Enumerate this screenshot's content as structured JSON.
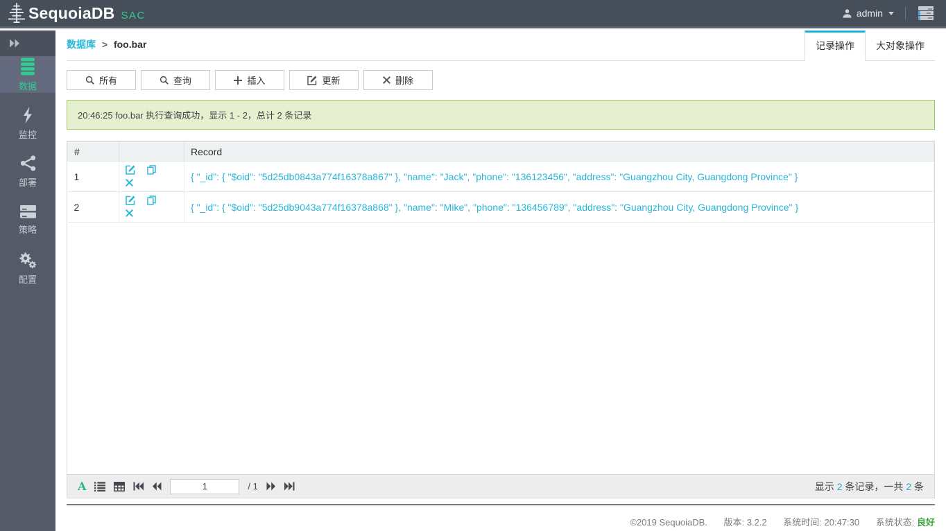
{
  "colors": {
    "accent_cyan": "#29b6d8",
    "accent_green": "#2fcc8f",
    "status_green": "#3fa33f",
    "alert_bg": "#e6f0d0",
    "alert_border": "#9cc964",
    "header_bg": "#454e59",
    "sidebar_bg": "#555a68"
  },
  "header": {
    "brand": "SequoiaDB",
    "brand_suffix": "SAC",
    "logo_icon": "sequoia-tree-icon",
    "user": "admin",
    "user_icon": "user-icon",
    "menu_icon": "server-stack-icon"
  },
  "sidebar": {
    "collapse_icon": "double-chevron-right-icon",
    "items": [
      {
        "label": "数据",
        "icon": "database-icon",
        "active": true
      },
      {
        "label": "监控",
        "icon": "lightning-icon",
        "active": false
      },
      {
        "label": "部署",
        "icon": "share-nodes-icon",
        "active": false
      },
      {
        "label": "策略",
        "icon": "server-icon",
        "active": false
      },
      {
        "label": "配置",
        "icon": "gears-icon",
        "active": false
      }
    ]
  },
  "breadcrumb": {
    "parent": "数据库",
    "separator": ">",
    "current": "foo.bar"
  },
  "tabs": [
    {
      "label": "记录操作",
      "active": true
    },
    {
      "label": "大对象操作",
      "active": false
    }
  ],
  "toolbar": {
    "buttons": [
      {
        "label": "所有",
        "icon": "search-icon"
      },
      {
        "label": "查询",
        "icon": "search-icon"
      },
      {
        "label": "插入",
        "icon": "plus-icon"
      },
      {
        "label": "更新",
        "icon": "edit-icon"
      },
      {
        "label": "删除",
        "icon": "delete-x-icon"
      }
    ]
  },
  "alert": {
    "message": "20:46:25 foo.bar 执行查询成功，显示 1 - 2，总计 2 条记录"
  },
  "table": {
    "headers": {
      "index_col": "#",
      "actions_col": "",
      "record_col": "Record"
    },
    "row_action_icons": [
      "edit-icon",
      "copy-icon",
      "delete-x-icon"
    ],
    "rows": [
      {
        "index": "1",
        "record": "{ \"_id\": { \"$oid\": \"5d25db0843a774f16378a867\" }, \"name\": \"Jack\", \"phone\": \"136123456\", \"address\": \"Guangzhou City, Guangdong Province\" }"
      },
      {
        "index": "2",
        "record": "{ \"_id\": { \"$oid\": \"5d25db9043a774f16378a868\" }, \"name\": \"Mike\", \"phone\": \"136456789\", \"address\": \"Guangzhou City, Guangdong Province\" }"
      }
    ]
  },
  "pagination": {
    "font_toggle": "A",
    "icons": [
      "font-icon",
      "list-icon",
      "table-grid-icon",
      "first-page-icon",
      "prev-page-icon",
      "next-page-icon",
      "last-page-icon"
    ],
    "page": "1",
    "total": "/ 1",
    "summary_prefix": "显示 ",
    "summary_count": "2",
    "summary_mid": " 条记录，一共 ",
    "summary_count2": "2",
    "summary_suffix": " 条"
  },
  "footer": {
    "copyright": "©2019 SequoiaDB.",
    "version_label": "版本: ",
    "version": "3.2.2",
    "time_label": "系统时间: ",
    "time": "20:47:30",
    "status_label": "系统状态: ",
    "status": "良好"
  }
}
